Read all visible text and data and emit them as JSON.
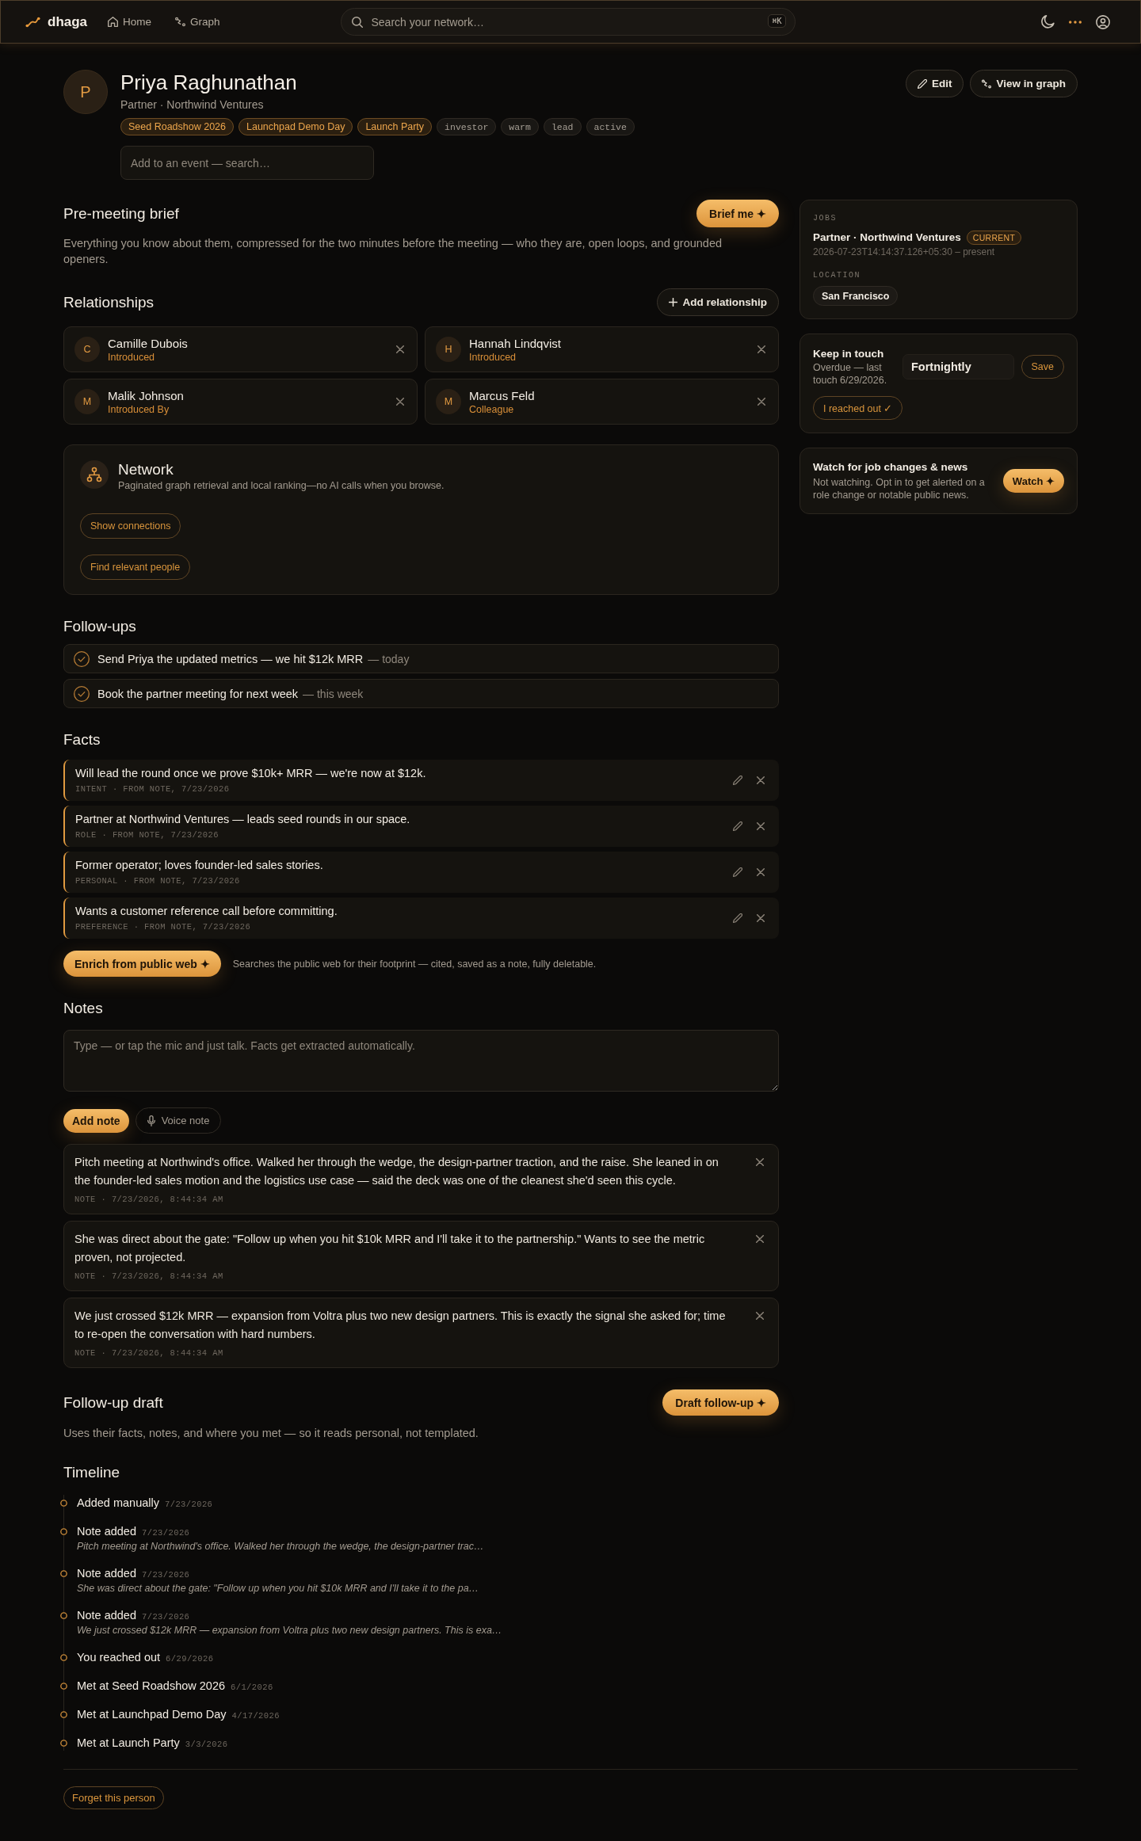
{
  "topbar": {
    "brand": "dhaga",
    "nav": [
      {
        "label": "Home"
      },
      {
        "label": "Graph"
      }
    ],
    "search": {
      "placeholder": "Search your network…",
      "shortcut": "⌘K"
    }
  },
  "profile": {
    "initial": "P",
    "name": "Priya Raghunathan",
    "subtitle": "Partner · Northwind Ventures",
    "tags": [
      {
        "label": "Seed Roadshow 2026",
        "kind": "event"
      },
      {
        "label": "Launchpad Demo Day",
        "kind": "event"
      },
      {
        "label": "Launch Party",
        "kind": "event"
      },
      {
        "label": "investor",
        "kind": "tag"
      },
      {
        "label": "warm",
        "kind": "tag"
      },
      {
        "label": "lead",
        "kind": "tag"
      },
      {
        "label": "active",
        "kind": "tag"
      }
    ],
    "event_search": {
      "placeholder": "Add to an event — search…"
    },
    "actions": [
      {
        "label": "Edit"
      },
      {
        "label": "View in graph"
      }
    ]
  },
  "brief": {
    "title": "Pre-meeting brief",
    "button": "Brief me ✦",
    "description": "Everything you know about them, compressed for the two minutes before the meeting — who they are, open loops, and grounded openers."
  },
  "relationships": {
    "title": "Relationships",
    "button": "Add relationship",
    "items": [
      {
        "initial": "C",
        "name": "Camille Dubois",
        "relation": "Introduced"
      },
      {
        "initial": "H",
        "name": "Hannah Lindqvist",
        "relation": "Introduced"
      },
      {
        "initial": "M",
        "name": "Malik Johnson",
        "relation": "Introduced By"
      },
      {
        "initial": "M",
        "name": "Marcus Feld",
        "relation": "Colleague"
      }
    ]
  },
  "network": {
    "title": "Network",
    "description": "Paginated graph retrieval and local ranking—no AI calls when you browse.",
    "buttons": [
      "Show connections",
      "Find relevant people"
    ]
  },
  "follow_ups": {
    "title": "Follow-ups",
    "items": [
      {
        "text": "Send Priya the updated metrics — we hit $12k MRR",
        "due": "— today"
      },
      {
        "text": "Book the partner meeting for next week",
        "due": "— this week"
      }
    ]
  },
  "facts": {
    "title": "Facts",
    "items": [
      {
        "text": "Will lead the round once we prove $10k+ MRR — we're now at $12k.",
        "meta": "INTENT · FROM NOTE, 7/23/2026"
      },
      {
        "text": "Partner at Northwind Ventures — leads seed rounds in our space.",
        "meta": "ROLE · FROM NOTE, 7/23/2026"
      },
      {
        "text": "Former operator; loves founder-led sales stories.",
        "meta": "PERSONAL · FROM NOTE, 7/23/2026"
      },
      {
        "text": "Wants a customer reference call before committing.",
        "meta": "PREFERENCE · FROM NOTE, 7/23/2026"
      }
    ],
    "enrich_button": "Enrich from public web ✦",
    "enrich_hint": "Searches the public web for their footprint — cited, saved as a note, fully deletable."
  },
  "notes": {
    "title": "Notes",
    "input": {
      "placeholder": "Type — or tap the mic and just talk. Facts get extracted automatically."
    },
    "add_button": "Add note",
    "voice_button": "Voice note",
    "items": [
      {
        "text": "Pitch meeting at Northwind's office. Walked her through the wedge, the design-partner traction, and the raise. She leaned in on the founder-led sales motion and the logistics use case — said the deck was one of the cleanest she'd seen this cycle.",
        "meta": "NOTE · 7/23/2026, 8:44:34 AM"
      },
      {
        "text": "She was direct about the gate: \"Follow up when you hit $10k MRR and I'll take it to the partnership.\" Wants to see the metric proven, not projected.",
        "meta": "NOTE · 7/23/2026, 8:44:34 AM"
      },
      {
        "text": "We just crossed $12k MRR — expansion from Voltra plus two new design partners. This is exactly the signal she asked for; time to re-open the conversation with hard numbers.",
        "meta": "NOTE · 7/23/2026, 8:44:34 AM"
      }
    ]
  },
  "follow_up_draft": {
    "title": "Follow-up draft",
    "button": "Draft follow-up ✦",
    "description": "Uses their facts, notes, and where you met — so it reads personal, not templated."
  },
  "timeline": {
    "title": "Timeline",
    "items": [
      {
        "title": "Added manually",
        "date": "7/23/2026"
      },
      {
        "title": "Note added",
        "date": "7/23/2026",
        "excerpt": "Pitch meeting at Northwind's office. Walked her through the wedge, the design-partner trac…"
      },
      {
        "title": "Note added",
        "date": "7/23/2026",
        "excerpt": "She was direct about the gate: \"Follow up when you hit $10k MRR and I'll take it to the pa…"
      },
      {
        "title": "Note added",
        "date": "7/23/2026",
        "excerpt": "We just crossed $12k MRR — expansion from Voltra plus two new design partners. This is exa…"
      },
      {
        "title": "You reached out",
        "date": "6/29/2026"
      },
      {
        "title": "Met at Seed Roadshow 2026",
        "date": "6/1/2026"
      },
      {
        "title": "Met at Launchpad Demo Day",
        "date": "4/17/2026"
      },
      {
        "title": "Met at Launch Party",
        "date": "3/3/2026"
      }
    ]
  },
  "sidebar": {
    "job_card": {
      "jobs_label": "JOBS",
      "job_title": "Partner · Northwind Ventures",
      "badge": "CURRENT",
      "dates": "2026-07-23T14:14:37.126+05:30 – present",
      "location_label": "LOCATION",
      "location": "San Francisco"
    },
    "keep_in_touch": {
      "title": "Keep in touch",
      "status": "Overdue — last touch 6/29/2026.",
      "frequency": "Fortnightly",
      "save_button": "Save",
      "reached_button": "I reached out ✓"
    },
    "watch": {
      "title": "Watch for job changes & news",
      "description": "Not watching. Opt in to get alerted on a role change or notable public news.",
      "button": "Watch ✦"
    }
  },
  "footer": {
    "button": "Forget this person"
  }
}
